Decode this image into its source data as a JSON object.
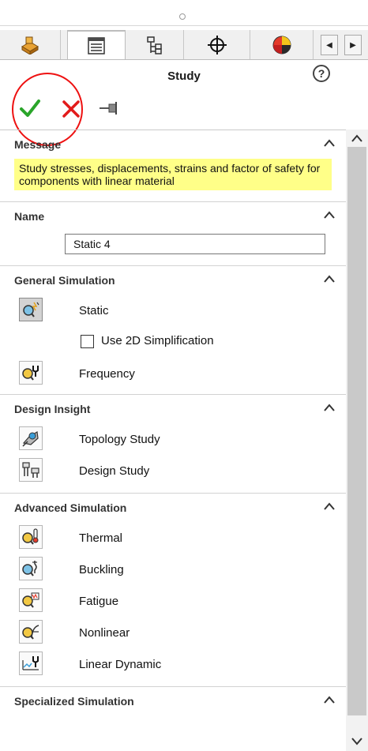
{
  "panel": {
    "title": "Study",
    "help_symbol": "?"
  },
  "tabs": [
    {
      "icon": "feature-manager-icon"
    },
    {
      "icon": "property-manager-icon"
    },
    {
      "icon": "configuration-manager-icon"
    },
    {
      "icon": "dimxpert-manager-icon"
    },
    {
      "icon": "display-manager-icon"
    }
  ],
  "sections": {
    "message": {
      "header": "Message",
      "text": "Study stresses, displacements, strains and factor of safety  for components with linear material"
    },
    "name": {
      "header": "Name",
      "value": "Static 4"
    },
    "general": {
      "header": "General Simulation",
      "static": "Static",
      "use_2d": "Use 2D Simplification",
      "frequency": "Frequency"
    },
    "design": {
      "header": "Design Insight",
      "topology": "Topology Study",
      "design_study": "Design Study"
    },
    "advanced": {
      "header": "Advanced Simulation",
      "thermal": "Thermal",
      "buckling": "Buckling",
      "fatigue": "Fatigue",
      "nonlinear": "Nonlinear",
      "linear_dynamic": "Linear Dynamic"
    },
    "specialized": {
      "header": "Specialized Simulation"
    }
  },
  "colors": {
    "message_bg": "#ffff88",
    "ok_green": "#2aa52a",
    "cancel_red": "#e21b1b",
    "highlight_ring": "#ee1111"
  }
}
